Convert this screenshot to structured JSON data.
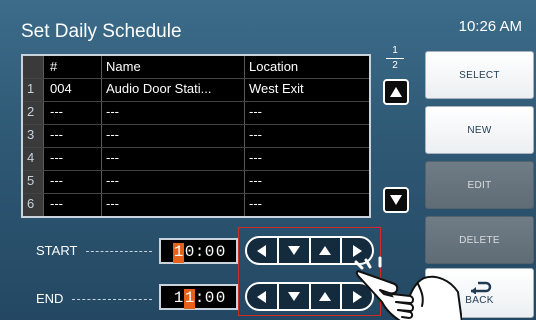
{
  "header": {
    "title": "Set Daily Schedule",
    "clock": "10:26 AM"
  },
  "table": {
    "columns": [
      "#",
      "Name",
      "Location"
    ],
    "rows": [
      {
        "idx": "1",
        "num": "004",
        "name": "Audio Door Stati...",
        "location": "West Exit"
      },
      {
        "idx": "2",
        "num": "---",
        "name": "---",
        "location": "---"
      },
      {
        "idx": "3",
        "num": "---",
        "name": "---",
        "location": "---"
      },
      {
        "idx": "4",
        "num": "---",
        "name": "---",
        "location": "---"
      },
      {
        "idx": "5",
        "num": "---",
        "name": "---",
        "location": "---"
      },
      {
        "idx": "6",
        "num": "---",
        "name": "---",
        "location": "---"
      }
    ],
    "page_current": "1",
    "page_total": "2"
  },
  "buttons": {
    "select": "SELECT",
    "new": "NEW",
    "edit": "EDIT",
    "delete": "DELETE",
    "back": "BACK"
  },
  "start": {
    "label": "START",
    "digits": [
      "1",
      "0",
      ":",
      "0",
      "0"
    ],
    "selected_digit": 0
  },
  "end": {
    "label": "END",
    "digits": [
      "1",
      "1",
      ":",
      "0",
      "0"
    ],
    "selected_digit": 1
  },
  "colors": {
    "background": "#2e5874",
    "selection": "#e8611a",
    "highlight_box": "#d02b2b"
  },
  "icons": [
    "up-arrow-icon",
    "down-arrow-icon",
    "left-arrow-icon",
    "right-arrow-icon",
    "back-icon",
    "hand-pointer-icon"
  ]
}
